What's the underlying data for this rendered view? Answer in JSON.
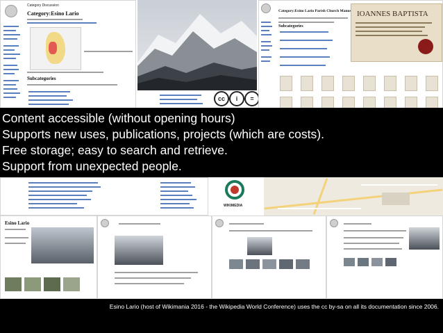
{
  "overlay": {
    "lines": [
      "Content accessible (without opening hours)",
      "Supports new uses, publications, projects (which are costs).",
      "Free storage; easy to search and retrieve.",
      "Support from unexpected people."
    ]
  },
  "caption": "Esino Lario (host of Wikimania 2016 - the Wikipedia World Conference) uses the cc by-sa on all its documentation since 2006.",
  "screens": {
    "category_title": "Category:Esino Lario",
    "category_page_title": "Category:Esino Lario Parish Church Manuscripts",
    "manuscript_heading": "IOANNES BAPTISTA",
    "wikimedia_label": "WIKIMEDIA",
    "commons_title_1": "Esino Lario",
    "cc_badges": [
      "cc",
      "i",
      "="
    ]
  },
  "colors": {
    "overlay_bg": "#000000",
    "overlay_text": "#ffffff",
    "link_blue": "#5a7fbf"
  }
}
